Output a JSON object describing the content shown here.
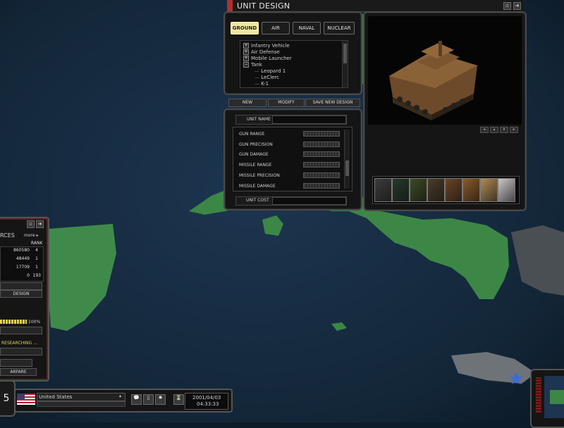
{
  "window": {
    "title": "UNIT DESIGN"
  },
  "tabs": [
    {
      "label": "GROUND",
      "active": true
    },
    {
      "label": "AIR",
      "active": false
    },
    {
      "label": "NAVAL",
      "active": false
    },
    {
      "label": "NUCLEAR",
      "active": false
    }
  ],
  "tree": [
    {
      "label": "Infantry Vehicle",
      "expander": "+"
    },
    {
      "label": "Air Defense",
      "expander": "+"
    },
    {
      "label": "Mobile Launcher",
      "expander": "+"
    },
    {
      "label": "Tank",
      "expander": "−"
    },
    {
      "label": "Leopard 1",
      "expander": ""
    },
    {
      "label": "LeClerc",
      "expander": ""
    },
    {
      "label": "K-1",
      "expander": ""
    }
  ],
  "actions": {
    "new": "NEW",
    "modify": "MODIFY",
    "save_new": "SAVE NEW DESIGN"
  },
  "unit": {
    "name_label": "UNIT NAME",
    "cost_label": "UNIT COST"
  },
  "stats": [
    "GUN RANGE",
    "GUN PRECISION",
    "GUN DAMAGE",
    "MISSILE RANGE",
    "MISSILE PRECISION",
    "MISSILE DAMAGE"
  ],
  "colors": {
    "swatches": [
      "#3c3c3c",
      "#253a2a",
      "#3d4a24",
      "#4a3c28",
      "#6b4424",
      "#8c5a26",
      "#b08a55",
      "#c8c8c8"
    ]
  },
  "side_panel": {
    "title": "RCES",
    "more": "more ▸",
    "rank_header": "RANK",
    "rows": [
      {
        "value": "860580",
        "rank": "4"
      },
      {
        "value": "48449",
        "rank": "1"
      },
      {
        "value": "17709",
        "rank": "1"
      },
      {
        "value": "0",
        "rank": "193"
      }
    ],
    "design_button": "DESIGN",
    "progress_label": "100%",
    "progress": 1.0,
    "researching": "RESEARCHING ...",
    "warfare": "ARFARE"
  },
  "bottom": {
    "left_glyph": "5",
    "country": "United States",
    "date": "2001/04/03",
    "time": "04:33:33"
  }
}
